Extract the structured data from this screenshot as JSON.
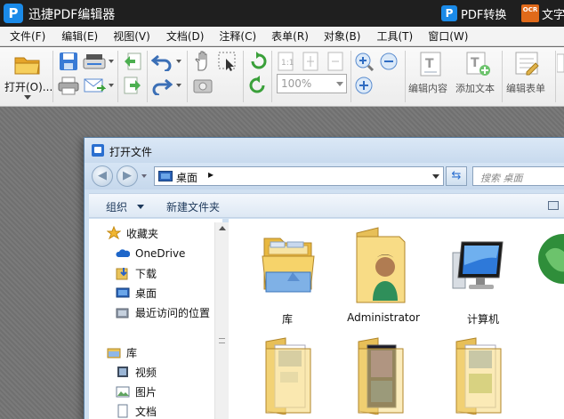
{
  "app": {
    "title": "迅捷PDF编辑器",
    "logo_letter": "P",
    "pdf_convert": "PDF转换",
    "ocr_badge": "OCR",
    "ocr_label": "文字"
  },
  "menu": [
    "文件(F)",
    "编辑(E)",
    "视图(V)",
    "文档(D)",
    "注释(C)",
    "表单(R)",
    "对象(B)",
    "工具(T)",
    "窗口(W)"
  ],
  "toolbar": {
    "open_label": "打开(O)...",
    "zoom_value": "100%",
    "edit_content": "编辑内容",
    "add_text": "添加文本",
    "edit_form": "编辑表单"
  },
  "dialog": {
    "title": "打开文件",
    "address_crumb": "桌面",
    "search_placeholder": "搜索 桌面",
    "organize": "组织",
    "new_folder": "新建文件夹"
  },
  "nav": {
    "favorites": "收藏夹",
    "onedrive": "OneDrive",
    "downloads": "下载",
    "desktop": "桌面",
    "recent": "最近访问的位置",
    "libraries": "库",
    "videos": "视频",
    "pictures": "图片",
    "documents": "文档"
  },
  "files": [
    "库",
    "Administrator",
    "计算机"
  ],
  "colors": {
    "titlebar": "#1f1f1f",
    "brand_blue": "#1a8ae8",
    "dialog_frame": "#cfe0f1",
    "folder_yellow": "#f2c94c"
  }
}
